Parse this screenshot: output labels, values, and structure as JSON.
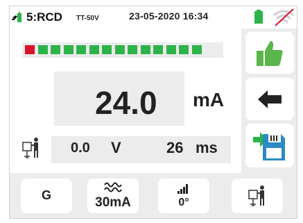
{
  "header": {
    "mode": "5:RCD",
    "system": "TT-50V",
    "datetime": "23-05-2020  16:34",
    "icons": {
      "connection": "plug-battery-icon",
      "battery": "battery-icon",
      "wireless": "wireless-off-icon"
    }
  },
  "bargraph": {
    "red_segments": 1,
    "green_segments": 13,
    "total_segments": 14
  },
  "measurement": {
    "main_value": "24.0",
    "main_unit": "mA",
    "voltage_value": "0.0",
    "voltage_unit": "V",
    "time_value": "26",
    "time_unit": "ms"
  },
  "side_buttons": [
    {
      "name": "ok-result",
      "icon": "thumbs-up-icon"
    },
    {
      "name": "back",
      "icon": "arrow-left-icon"
    },
    {
      "name": "save",
      "icon": "save-to-memory-icon"
    }
  ],
  "bottom_buttons": [
    {
      "name": "type",
      "label": "G"
    },
    {
      "name": "current",
      "label": "30mA",
      "icon": "ac-waveform-icon"
    },
    {
      "name": "phase",
      "label": "0°",
      "icon": "signal-steps-icon"
    },
    {
      "name": "contact-voltage",
      "icon": "touch-voltage-icon"
    }
  ],
  "colors": {
    "red": "#d8132b",
    "green": "#2db34a",
    "thumb_green": "#5ab64a",
    "panel": "#ececec"
  }
}
